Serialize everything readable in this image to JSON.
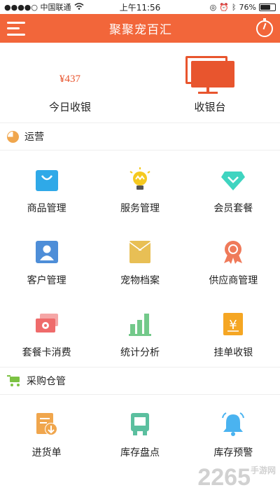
{
  "status": {
    "carrier": "●●●●○ 中国联通",
    "time": "上午11:56",
    "battery": "76%",
    "battery_level": 0.76
  },
  "nav": {
    "title": "聚聚宠百汇",
    "left_icon": "menu-icon",
    "right_icon": "timer-icon",
    "bg_color": "#f2663a"
  },
  "hero": {
    "today_amount": "¥437",
    "today_label": "今日收银",
    "cashier_label": "收银台"
  },
  "sections": {
    "ops": {
      "title": "运营"
    },
    "purchase": {
      "title": "采购仓管"
    }
  },
  "ops_items": [
    {
      "label": "商品管理",
      "icon": "shopping-bag-icon",
      "color": "#2fa9e8"
    },
    {
      "label": "服务管理",
      "icon": "lightbulb-icon",
      "color": "#f5c91f"
    },
    {
      "label": "会员套餐",
      "icon": "diamond-icon",
      "color": "#3fd4c0"
    },
    {
      "label": "客户管理",
      "icon": "customer-card-icon",
      "color": "#4e8ed8"
    },
    {
      "label": "宠物档案",
      "icon": "pet-file-icon",
      "color": "#e8bf55"
    },
    {
      "label": "供应商管理",
      "icon": "award-ribbon-icon",
      "color": "#ef7a5a"
    },
    {
      "label": "套餐卡消费",
      "icon": "package-card-icon",
      "color": "#ef6b6b"
    },
    {
      "label": "统计分析",
      "icon": "bar-chart-icon",
      "color": "#73c98a"
    },
    {
      "label": "挂单收银",
      "icon": "pending-order-icon",
      "color": "#f5a623"
    }
  ],
  "purchase_items": [
    {
      "label": "进货单",
      "icon": "purchase-order-icon",
      "color": "#f0a64d"
    },
    {
      "label": "库存盘点",
      "icon": "inventory-check-icon",
      "color": "#5bbf9f"
    },
    {
      "label": "库存预警",
      "icon": "alarm-bell-icon",
      "color": "#4ab3f0"
    }
  ],
  "watermark": "2265 手游网"
}
